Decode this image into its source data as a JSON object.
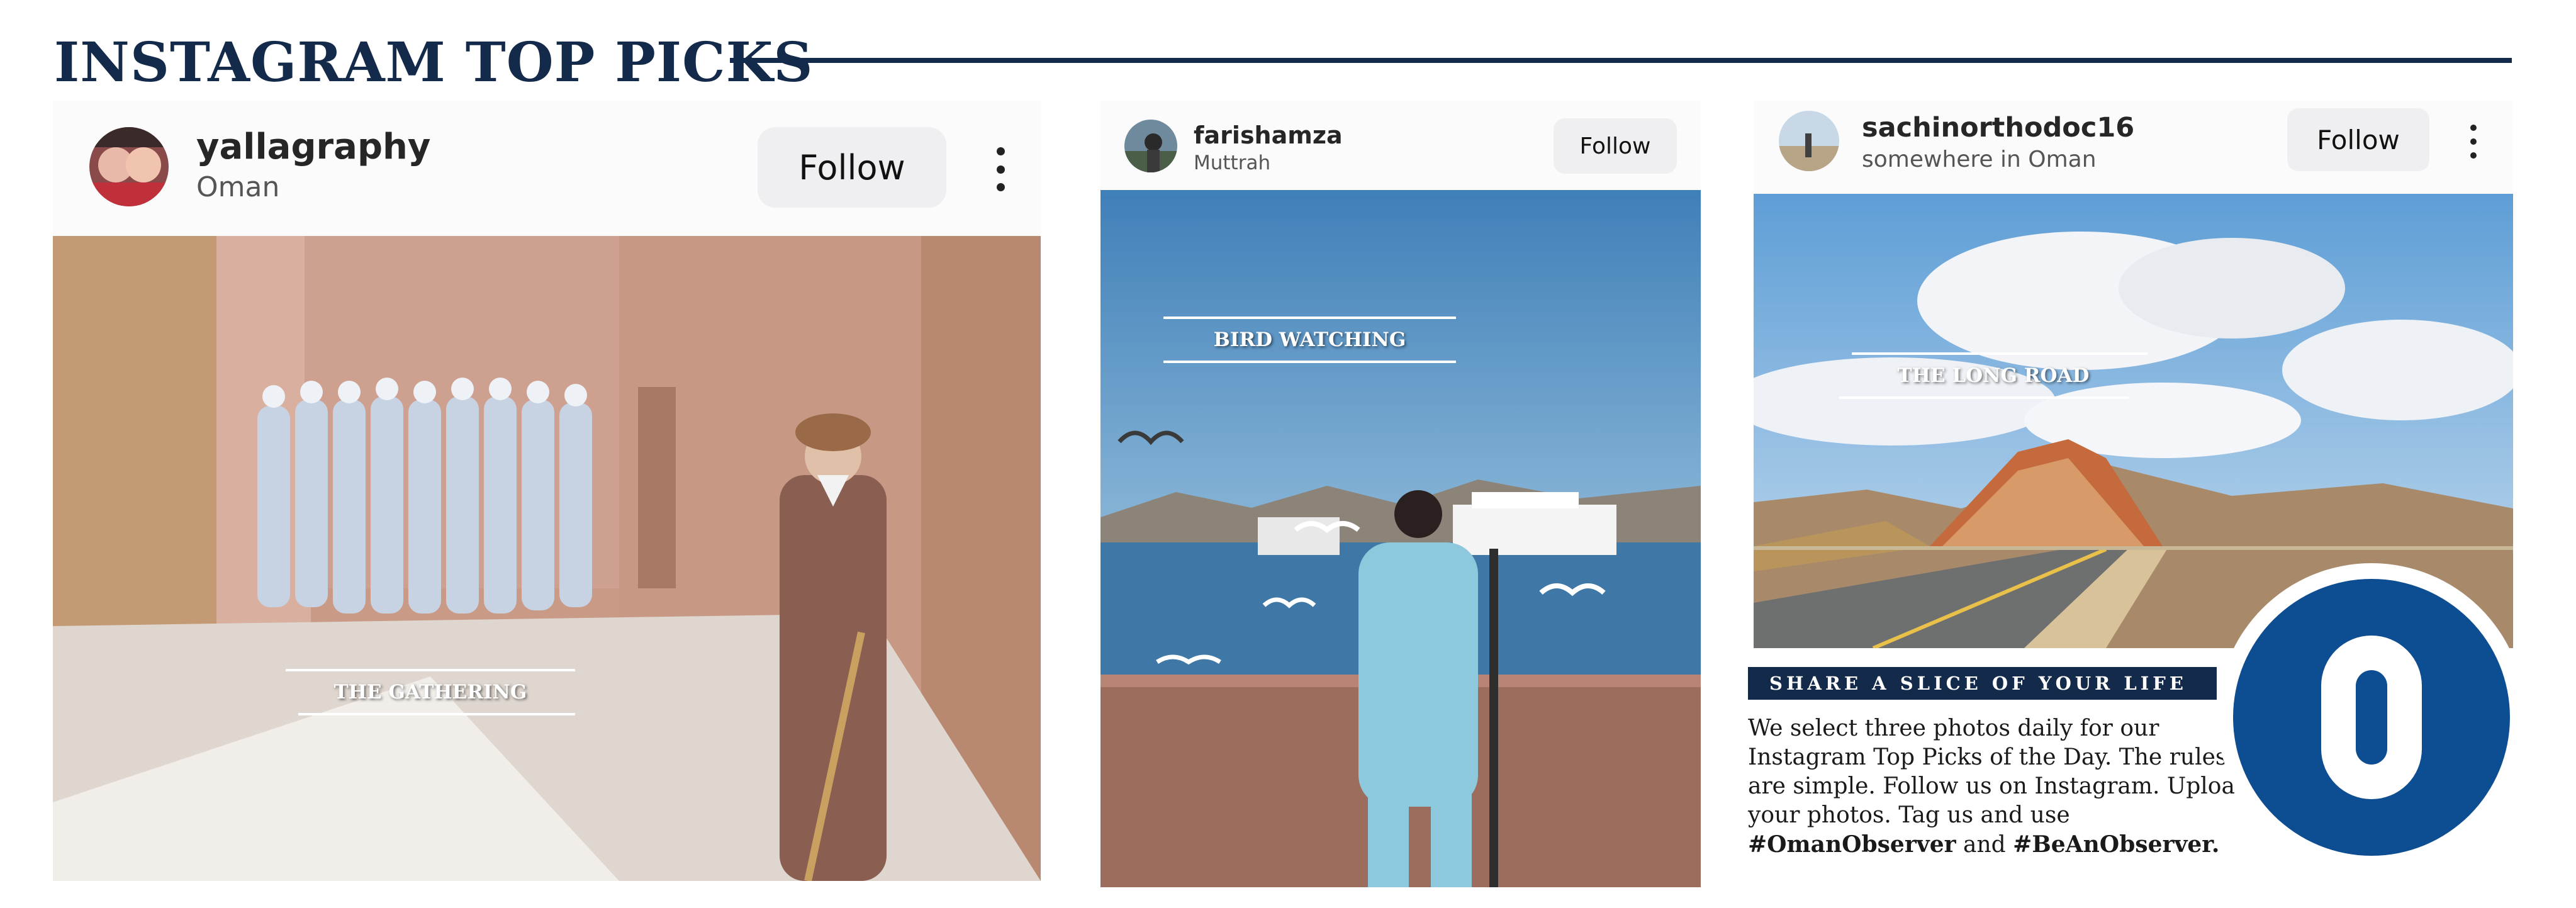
{
  "header": {
    "title": "INSTAGRAM TOP PICKS"
  },
  "posts": [
    {
      "username": "yallagraphy",
      "location": "Oman",
      "follow_label": "Follow",
      "caption": "THE GATHERING"
    },
    {
      "username": "farishamza",
      "location": "Muttrah",
      "follow_label": "Follow",
      "caption": "BIRD WATCHING"
    },
    {
      "username": "sachinorthodoc16",
      "location": "somewhere in Oman",
      "follow_label": "Follow",
      "caption": "THE LONG ROAD"
    }
  ],
  "promo": {
    "banner": "SHARE A SLICE OF YOUR LIFE",
    "text_main": "We select three photos daily for our Instagram Top Picks of the Day. The rules are simple. Follow us on Instagram. Upload your photos. Tag us and use ",
    "hashtag1": "#OmanObserver",
    "text_and": " and ",
    "hashtag2": "#BeAnObserver.",
    "logo_letter": "O"
  },
  "colors": {
    "navy": "#142a4a",
    "badge_blue": "#0d4d91"
  },
  "icons": [
    "avatar",
    "kebab-menu-icon",
    "observer-logo"
  ]
}
